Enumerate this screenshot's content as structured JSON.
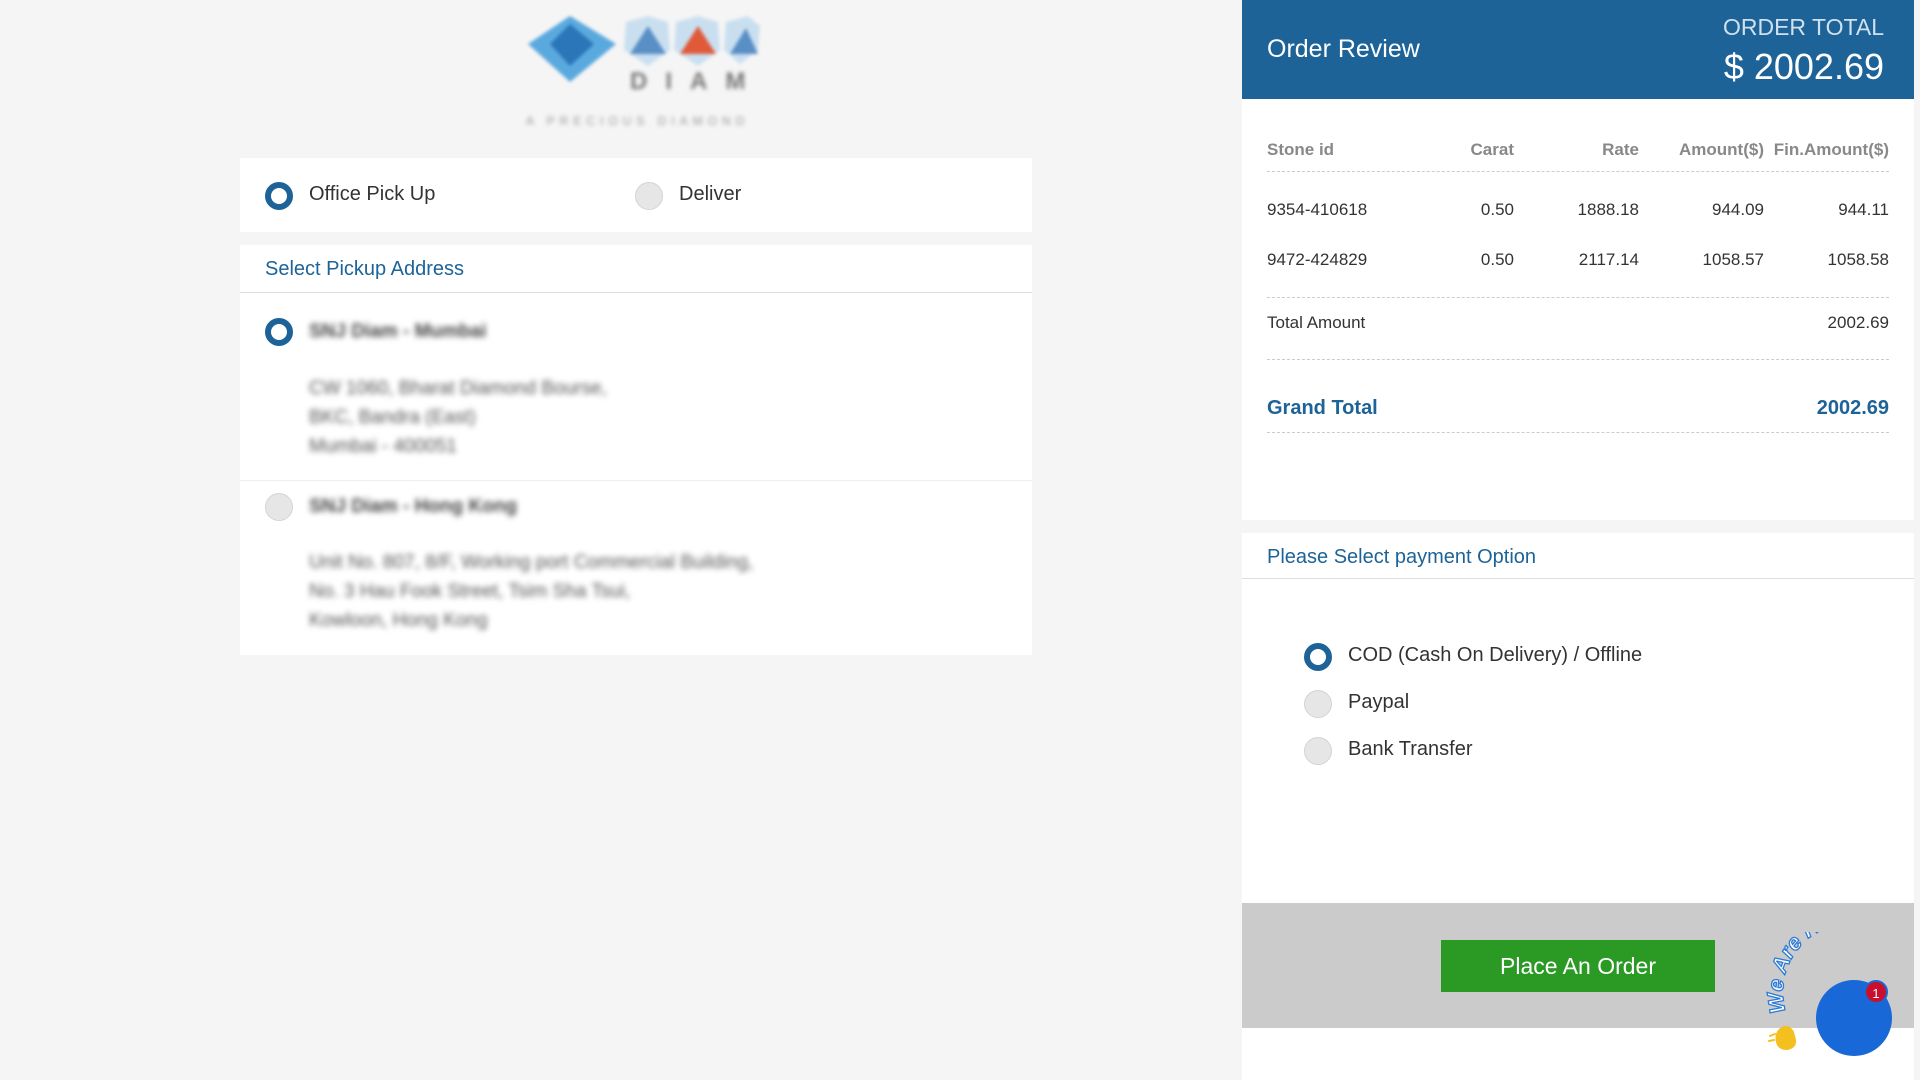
{
  "brand": {
    "name": "DIAM",
    "tagline": "A PRECIOUS DIAMOND"
  },
  "delivery_mode": {
    "options": [
      {
        "label": "Office Pick Up",
        "selected": true
      },
      {
        "label": "Deliver",
        "selected": false
      }
    ]
  },
  "pickup": {
    "title": "Select Pickup Address",
    "addresses": [
      {
        "name": "SNJ Diam - Mumbai",
        "selected": true,
        "lines": [
          "CW 1060, Bharat Diamond Bourse,",
          "BKC, Bandra (East)",
          "Mumbai - 400051"
        ]
      },
      {
        "name": "SNJ Diam - Hong Kong",
        "selected": false,
        "lines": [
          "Unit No. 807, 8/F, Working port Commercial Building,",
          "No. 3 Hau Fook Street, Tsim Sha Tsui,",
          "Kowloon, Hong Kong"
        ]
      }
    ]
  },
  "order_review": {
    "title": "Order Review",
    "total_label": "ORDER TOTAL",
    "total_value": "$ 2002.69",
    "columns": [
      "Stone id",
      "Carat",
      "Rate",
      "Amount($)",
      "Fin.Amount($)"
    ],
    "rows": [
      [
        "9354-410618",
        "0.50",
        "1888.18",
        "944.09",
        "944.11"
      ],
      [
        "9472-424829",
        "0.50",
        "2117.14",
        "1058.57",
        "1058.58"
      ]
    ],
    "total_amount_label": "Total Amount",
    "total_amount_value": "2002.69",
    "grand_total_label": "Grand Total",
    "grand_total_value": "2002.69"
  },
  "payment": {
    "title": "Please Select payment Option",
    "options": [
      {
        "label": "COD (Cash On Delivery) / Offline",
        "selected": true
      },
      {
        "label": "Paypal",
        "selected": false
      },
      {
        "label": "Bank Transfer",
        "selected": false
      }
    ]
  },
  "actions": {
    "place_order": "Place An Order"
  },
  "chat": {
    "text": "We Are Here!",
    "badge": "1"
  },
  "colors": {
    "primary": "#1d6397",
    "success": "#2a9a25",
    "badge": "#c8102e",
    "chat": "#1868d8"
  }
}
